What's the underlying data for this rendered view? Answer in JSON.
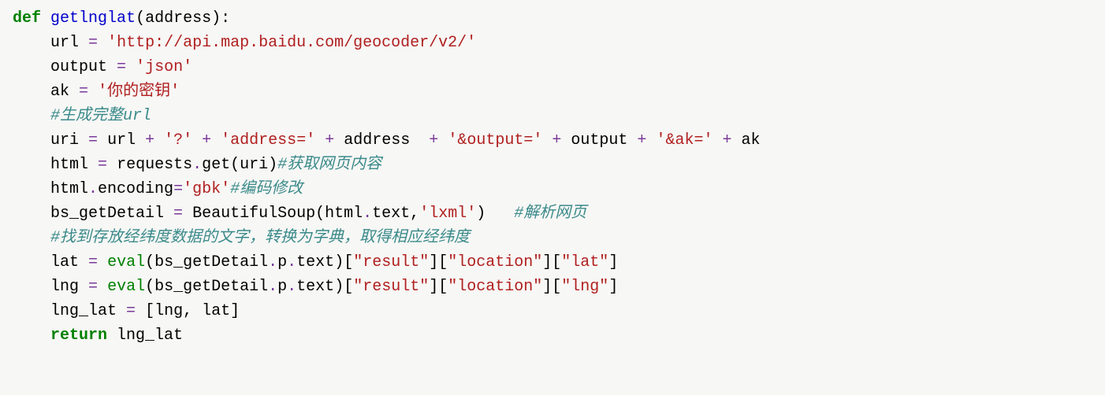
{
  "code": {
    "l1": {
      "kw": "def",
      "fn": "getlnglat",
      "paren_open": "(",
      "arg": "address",
      "paren_close": "):"
    },
    "l2": {
      "indent": "    ",
      "var": "url ",
      "op": "=",
      "sp": " ",
      "str": "'http://api.map.baidu.com/geocoder/v2/'"
    },
    "l3": {
      "indent": "    ",
      "var": "output ",
      "op": "=",
      "sp": " ",
      "str": "'json'"
    },
    "l4": {
      "indent": "    ",
      "var": "ak ",
      "op": "=",
      "sp": " ",
      "str": "'你的密钥'"
    },
    "l5": {
      "indent": "    ",
      "cmt": "#生成完整url"
    },
    "l6": {
      "indent": "    ",
      "var": "uri ",
      "op1": "=",
      "sp1": " ",
      "id1": "url ",
      "op2": "+",
      "sp2": " ",
      "str1": "'?'",
      "sp3": " ",
      "op3": "+",
      "sp4": " ",
      "str2": "'address='",
      "sp5": " ",
      "op4": "+",
      "sp6": " ",
      "id2": "address  ",
      "op5": "+",
      "sp7": " ",
      "str3": "'&output='",
      "sp8": " ",
      "op6": "+",
      "sp9": " ",
      "id3": "output ",
      "op7": "+",
      "sp10": " ",
      "str4": "'&ak='",
      "sp11": " ",
      "op8": "+",
      "sp12": " ",
      "id4": "ak"
    },
    "l7": {
      "indent": "    ",
      "var": "html ",
      "op": "=",
      "sp": " ",
      "call": "requests",
      "dot": ".",
      "method": "get",
      "paren": "(uri)",
      "cmt": "#获取网页内容"
    },
    "l8": {
      "indent": "    ",
      "lhs": "html",
      "dot": ".",
      "attr": "encoding",
      "op": "=",
      "str": "'gbk'",
      "cmt": "#编码修改"
    },
    "l9": {
      "indent": "    ",
      "var": "bs_getDetail ",
      "op": "=",
      "sp": " ",
      "cls": "BeautifulSoup",
      "paren_open": "(",
      "arg1": "html",
      "dot": ".",
      "attr": "text",
      "comma": ",",
      "str": "'lxml'",
      "paren_close": ")",
      "pad": "   ",
      "cmt": "#解析网页"
    },
    "l10": {
      "indent": "    ",
      "cmt": "#找到存放经纬度数据的文字，转换为字典，取得相应经纬度"
    },
    "l11": {
      "indent": "    ",
      "var": "lat ",
      "op": "=",
      "sp": " ",
      "builtin": "eval",
      "paren_open": "(",
      "expr": "bs_getDetail",
      "dot1": ".",
      "p1": "p",
      "dot2": ".",
      "p2": "text",
      "paren_close": ")",
      "b1": "[",
      "k1": "\"result\"",
      "b2": "][",
      "k2": "\"location\"",
      "b3": "][",
      "k3": "\"lat\"",
      "b4": "]"
    },
    "l12": {
      "indent": "    ",
      "var": "lng ",
      "op": "=",
      "sp": " ",
      "builtin": "eval",
      "paren_open": "(",
      "expr": "bs_getDetail",
      "dot1": ".",
      "p1": "p",
      "dot2": ".",
      "p2": "text",
      "paren_close": ")",
      "b1": "[",
      "k1": "\"result\"",
      "b2": "][",
      "k2": "\"location\"",
      "b3": "][",
      "k3": "\"lng\"",
      "b4": "]"
    },
    "l13": {
      "indent": "    ",
      "var": "lng_lat ",
      "op": "=",
      "sp": " ",
      "list": "[lng, lat]"
    },
    "l14": {
      "indent": "    ",
      "kw": "return",
      "sp": " ",
      "var": "lng_lat"
    }
  }
}
